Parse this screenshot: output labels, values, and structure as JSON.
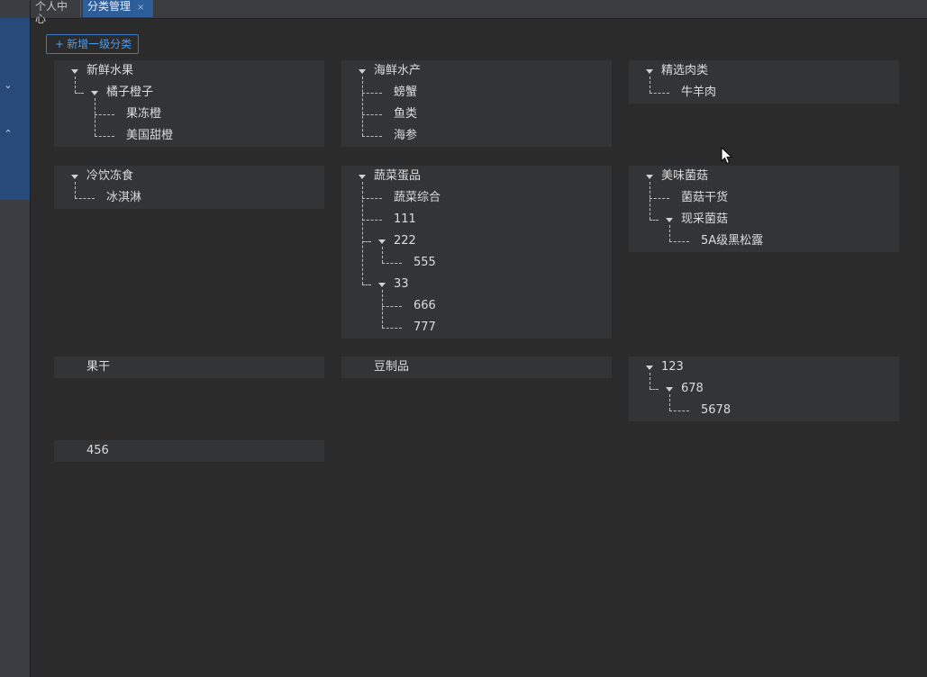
{
  "tabs": [
    {
      "label": "个人中心",
      "active": false
    },
    {
      "label": "分类管理",
      "active": true,
      "close": "×"
    }
  ],
  "sidebar": {
    "expand_icon": "chevron-down-icon",
    "collapse_icon": "chevron-up-icon",
    "accent": "#284a7a"
  },
  "toolbar": {
    "add_plus": "+",
    "add_label": "新增一级分类",
    "accent": "#3a78c4"
  },
  "cards": [
    {
      "name": "新鲜水果",
      "children": [
        {
          "name": "橘子橙子",
          "children": [
            {
              "name": "果冻橙"
            },
            {
              "name": "美国甜橙"
            }
          ]
        }
      ]
    },
    {
      "name": "海鲜水产",
      "children": [
        {
          "name": "螃蟹"
        },
        {
          "name": "鱼类"
        },
        {
          "name": "海参"
        }
      ]
    },
    {
      "name": "精选肉类",
      "children": [
        {
          "name": "牛羊肉"
        }
      ]
    },
    {
      "name": "冷饮冻食",
      "children": [
        {
          "name": "冰淇淋"
        }
      ]
    },
    {
      "name": "蔬菜蛋品",
      "children": [
        {
          "name": "蔬菜综合"
        },
        {
          "name": "111"
        },
        {
          "name": "222",
          "children": [
            {
              "name": "555"
            }
          ]
        },
        {
          "name": "33",
          "children": [
            {
              "name": "666"
            },
            {
              "name": "777"
            }
          ]
        }
      ]
    },
    {
      "name": "美味菌菇",
      "children": [
        {
          "name": "菌菇干货"
        },
        {
          "name": "现采菌菇",
          "children": [
            {
              "name": "5A级黑松露"
            }
          ]
        }
      ]
    },
    {
      "name": "果干"
    },
    {
      "name": "豆制品"
    },
    {
      "name": "123",
      "children": [
        {
          "name": "678",
          "children": [
            {
              "name": "5678"
            }
          ]
        }
      ]
    },
    {
      "name": "456"
    }
  ]
}
